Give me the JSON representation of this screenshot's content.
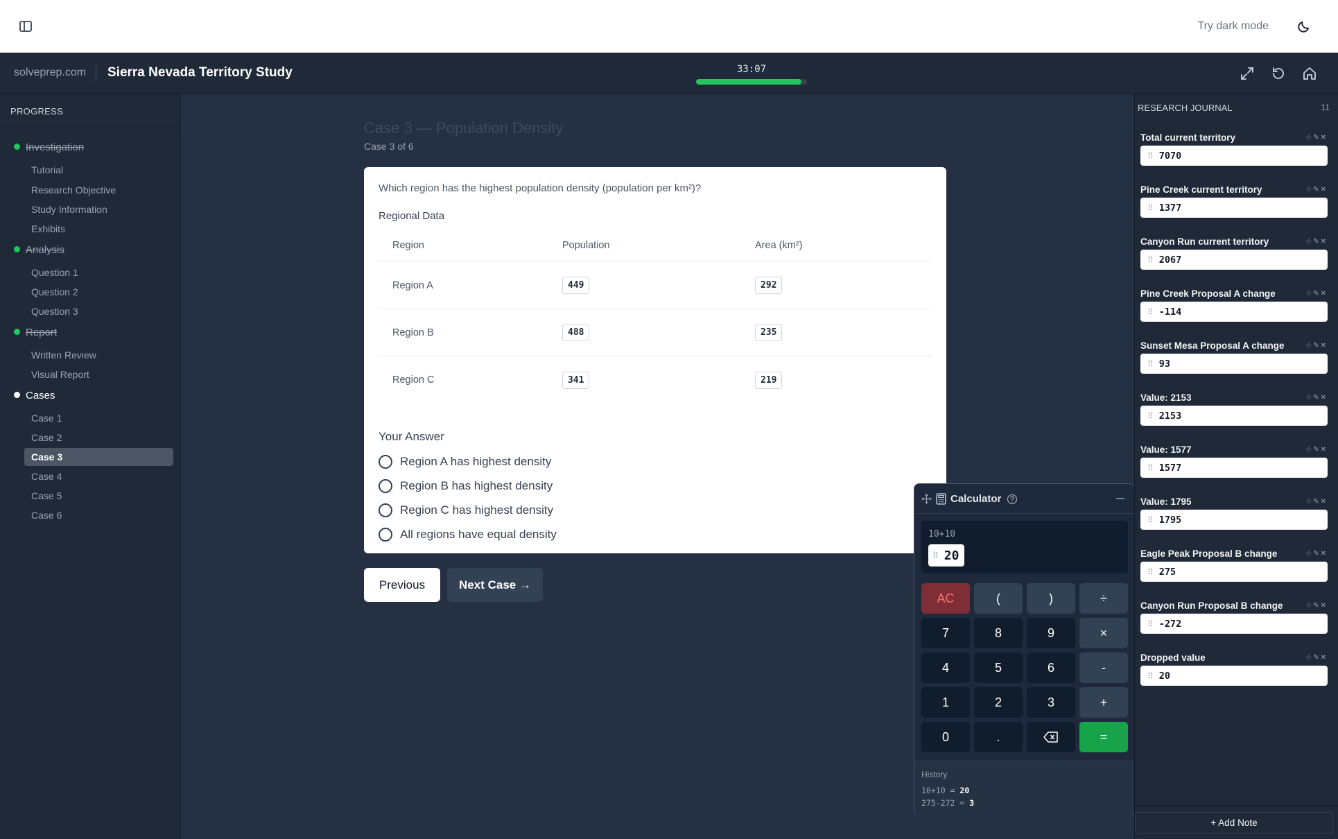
{
  "topbar": {
    "dark_mode_label": "Try dark mode"
  },
  "header": {
    "brand": "solveprep.com",
    "title": "Sierra Nevada Territory Study",
    "timer": "33:07",
    "progress_fraction": 0.95
  },
  "sidebar": {
    "heading": "PROGRESS",
    "sections": [
      {
        "label": "Investigation",
        "items": [
          "Tutorial",
          "Research Objective",
          "Study Information",
          "Exhibits"
        ]
      },
      {
        "label": "Analysis",
        "items": [
          "Question 1",
          "Question 2",
          "Question 3"
        ]
      },
      {
        "label": "Report",
        "items": [
          "Written Review",
          "Visual Report"
        ]
      },
      {
        "label": "Cases",
        "items": [
          "Case 1",
          "Case 2",
          "Case 3",
          "Case 4",
          "Case 5",
          "Case 6"
        ]
      }
    ]
  },
  "main": {
    "case_title": "Case 3 — Population Density",
    "case_sub": "Case 3 of 6",
    "question": "Which region has the highest population density (population per km²)?",
    "table_label": "Regional Data",
    "columns": [
      "Region",
      "Population",
      "Area (km²)"
    ],
    "rows": [
      {
        "region": "Region A",
        "population": "449",
        "area": "292"
      },
      {
        "region": "Region B",
        "population": "488",
        "area": "235"
      },
      {
        "region": "Region C",
        "population": "341",
        "area": "219"
      }
    ],
    "answer_label": "Your Answer",
    "options": [
      "Region A has highest density",
      "Region B has highest density",
      "Region C has highest density",
      "All regions have equal density"
    ],
    "prev_label": "Previous",
    "next_label": "Next Case →"
  },
  "calculator": {
    "title": "Calculator",
    "expression": "10+10",
    "result": "20",
    "keys": [
      "AC",
      "(",
      ")",
      "÷",
      "7",
      "8",
      "9",
      "×",
      "4",
      "5",
      "6",
      "-",
      "1",
      "2",
      "3",
      "+",
      "0",
      ".",
      "⌫",
      "="
    ],
    "history_label": "History",
    "history": [
      {
        "expr": "10+10 = ",
        "val": "20"
      },
      {
        "expr": "275-272 = ",
        "val": "3"
      }
    ]
  },
  "journal": {
    "heading": "RESEARCH JOURNAL",
    "count": "11",
    "entries": [
      {
        "label": "Total current territory",
        "value": "7070"
      },
      {
        "label": "Pine Creek current territory",
        "value": "1377"
      },
      {
        "label": "Canyon Run current territory",
        "value": "2067"
      },
      {
        "label": "Pine Creek Proposal A change",
        "value": "-114"
      },
      {
        "label": "Sunset Mesa Proposal A change",
        "value": "93"
      },
      {
        "label": "Value: 2153",
        "value": "2153"
      },
      {
        "label": "Value: 1577",
        "value": "1577"
      },
      {
        "label": "Value: 1795",
        "value": "1795"
      },
      {
        "label": "Eagle Peak Proposal B change",
        "value": "275"
      },
      {
        "label": "Canyon Run Proposal B change",
        "value": "-272"
      },
      {
        "label": "Dropped value",
        "value": "20"
      }
    ],
    "add_note_label": "+ Add Note"
  }
}
